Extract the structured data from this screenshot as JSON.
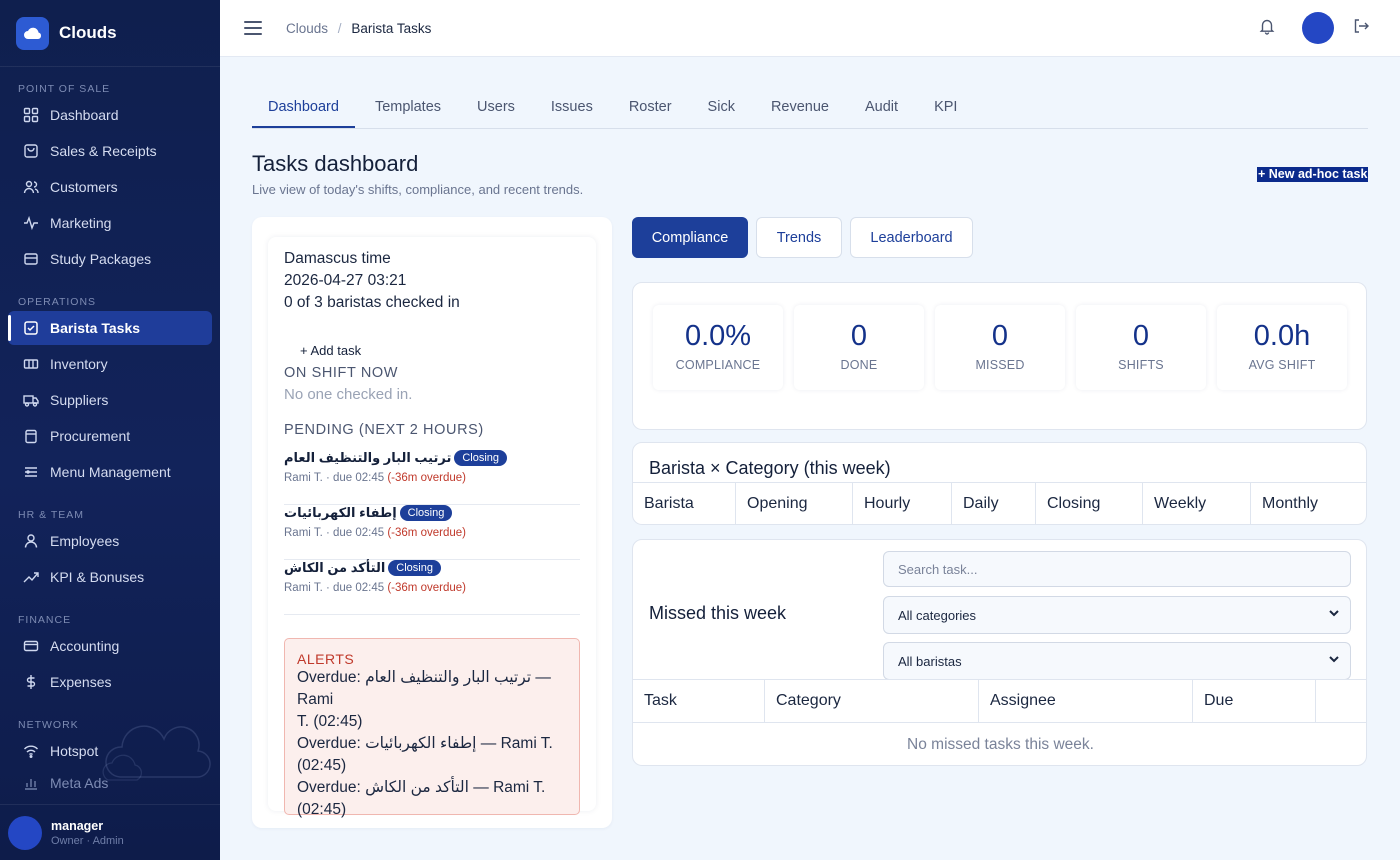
{
  "brand": {
    "name": "Clouds"
  },
  "sidebar": {
    "sections": {
      "pos": "POINT OF SALE",
      "ops": "OPERATIONS",
      "hr": "HR & TEAM",
      "finance": "FINANCE",
      "network": "NETWORK"
    },
    "items": {
      "dashboard": "Dashboard",
      "sales": "Sales & Receipts",
      "customers": "Customers",
      "marketing": "Marketing",
      "study": "Study Packages",
      "barista": "Barista Tasks",
      "inventory": "Inventory",
      "suppliers": "Suppliers",
      "procurement": "Procurement",
      "menu": "Menu Management",
      "employees": "Employees",
      "kpi": "KPI & Bonuses",
      "accounting": "Accounting",
      "expenses": "Expenses",
      "hotspot": "Hotspot",
      "meta": "Meta Ads"
    },
    "user": {
      "name": "manager",
      "role": "Owner · Admin"
    }
  },
  "topbar": {
    "crumb_root": "Clouds",
    "crumb_sep": "/",
    "crumb_current": "Barista Tasks"
  },
  "tabs": [
    "Dashboard",
    "Templates",
    "Users",
    "Issues",
    "Roster",
    "Sick",
    "Revenue",
    "Audit",
    "KPI"
  ],
  "header": {
    "title": "Tasks dashboard",
    "subtitle": "Live view of today's shifts, compliance, and recent trends.",
    "new_task": "+ New ad-hoc task"
  },
  "status": {
    "tz_label": "Damascus time",
    "datetime": "2026-04-27 03:21",
    "checked_in": "0 of 3 baristas checked in",
    "add_task": "+ Add task",
    "on_shift_head": "ON SHIFT NOW",
    "on_shift_empty": "No one checked in.",
    "pending_head": "PENDING (NEXT 2 HOURS)"
  },
  "pending": [
    {
      "title": "ترتيب البار والتنظيف العام",
      "badge": "Closing",
      "meta": "Rami T. · due 02:45 ",
      "overdue": "(-36m overdue)"
    },
    {
      "title": "إطفاء الكهربائيات",
      "badge": "Closing",
      "meta": "Rami T. · due 02:45 ",
      "overdue": "(-36m overdue)"
    },
    {
      "title": "التأكد من الكاش",
      "badge": "Closing",
      "meta": "Rami T. · due 02:45 ",
      "overdue": "(-36m overdue)"
    }
  ],
  "alerts": {
    "head": "ALERTS",
    "lines": [
      "Overdue: ترتيب البار والتنظيف العام — Rami",
      "T. (02:45)",
      "Overdue: إطفاء الكهربائيات — Rami T.",
      "(02:45)",
      "Overdue: التأكد من الكاش — Rami T.",
      "(02:45)"
    ]
  },
  "segments": [
    "Compliance",
    "Trends",
    "Leaderboard"
  ],
  "kpis": [
    {
      "value": "0.0%",
      "label": "COMPLIANCE"
    },
    {
      "value": "0",
      "label": "DONE"
    },
    {
      "value": "0",
      "label": "MISSED"
    },
    {
      "value": "0",
      "label": "SHIFTS"
    },
    {
      "value": "0.0h",
      "label": "AVG SHIFT"
    }
  ],
  "category": {
    "title": "Barista × Category (this week)",
    "columns": [
      "Barista",
      "Opening",
      "Hourly",
      "Daily",
      "Closing",
      "Weekly",
      "Monthly"
    ]
  },
  "missed": {
    "title": "Missed this week",
    "search_placeholder": "Search task...",
    "category_select": "All categories",
    "barista_select": "All baristas",
    "columns": [
      "Task",
      "Category",
      "Assignee",
      "Due"
    ],
    "empty": "No missed tasks this week."
  },
  "colors": {
    "primary": "#1d3f9a",
    "sidebar": "#0f1f4e",
    "danger": "#c0392b"
  }
}
